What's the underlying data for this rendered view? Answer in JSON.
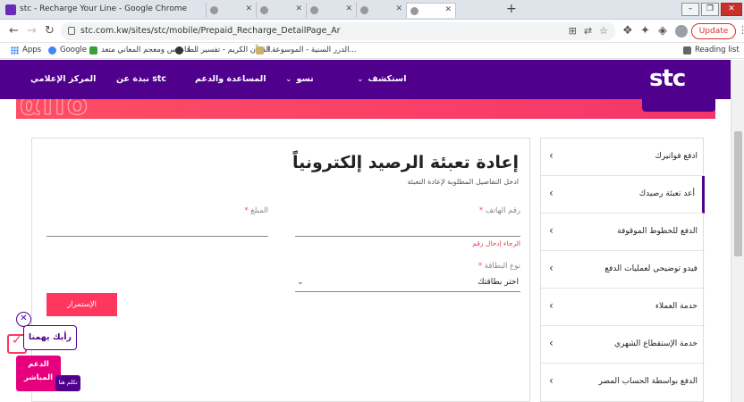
{
  "browser": {
    "window_title": "stc - Recharge Your Line - Google Chrome",
    "url": "stc.com.kw/sites/stc/mobile/Prepaid_Recharge_DetailPage_Ar",
    "update_label": "Update",
    "reading_list": "Reading list",
    "bookmarks": [
      {
        "label": "Apps"
      },
      {
        "label": "Google"
      },
      {
        "label": "قاموس ومعجم المعاني متعد..."
      },
      {
        "label": "القرآن الكريم - تفسير الط..."
      },
      {
        "label": "الدرر السنية - الموسوعة ا..."
      }
    ]
  },
  "site": {
    "logo": "stc",
    "nav": [
      {
        "label": "استكشف",
        "has_menu": true
      },
      {
        "label": "تسو",
        "has_menu": true
      },
      {
        "label": "المساعدة والدعم",
        "has_menu": false
      },
      {
        "label": "نبذة عن stc",
        "has_menu": false
      },
      {
        "label": "المركز الإعلامي",
        "has_menu": false
      }
    ]
  },
  "form": {
    "title": "إعادة تعبئة الرصيد إلكترونياً",
    "subtitle": "ادخل التفاصيل المطلوبة لإعادة التعبئة",
    "phone_label": "رقم الهاتف",
    "phone_error": "الرجاء إدخال رقم",
    "amount_label": "المبلغ",
    "card_label": "نوع البطاقة",
    "card_value": "اختر بطاقتك",
    "required_mark": "*",
    "continue_label": "الإستمرار"
  },
  "sidebar": {
    "items": [
      {
        "label": "ادفع فواتيرك"
      },
      {
        "label": "أعد تعبئة رصيدك"
      },
      {
        "label": "الدفع للخطوط الموقوفة"
      },
      {
        "label": "فيدو توضيحي لعمليات الدفع"
      },
      {
        "label": "خدمة العملاء"
      },
      {
        "label": "خدمة الإستقطاع الشهري"
      },
      {
        "label": "الدفع بواسطة الحساب المصر"
      }
    ],
    "active_index": 1
  },
  "widgets": {
    "feedback": "رأيك يهمنا",
    "support_line1": "الدعم",
    "support_line2": "المباشر",
    "chat": "تكلم هنا"
  },
  "colors": {
    "brand_purple": "#4f008c",
    "brand_coral": "#ff375e",
    "brand_magenta": "#e6007e"
  }
}
